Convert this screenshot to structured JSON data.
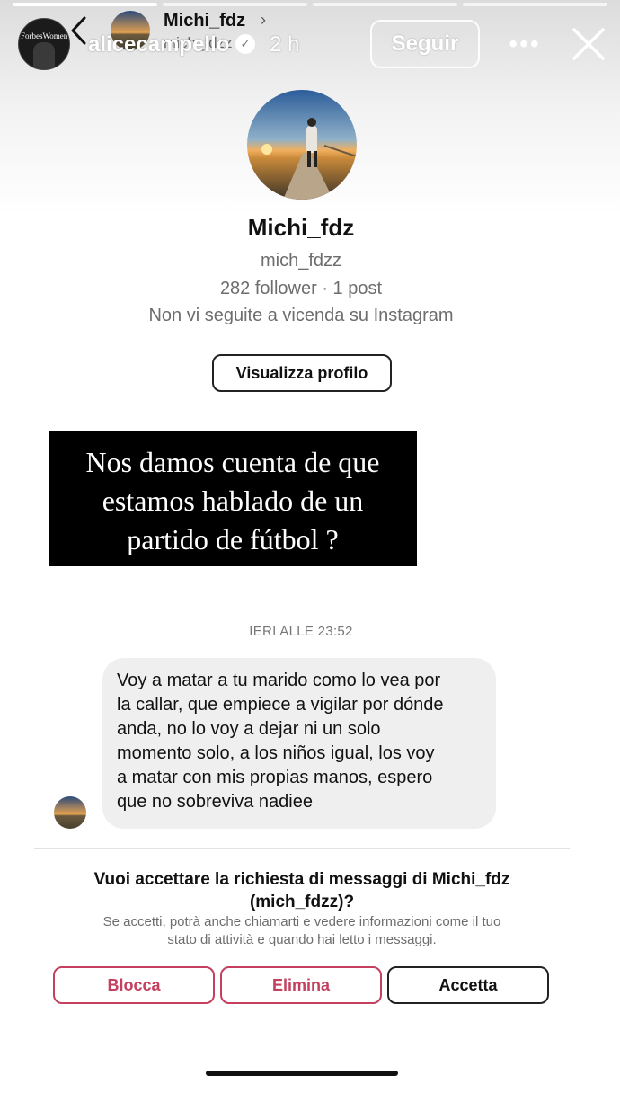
{
  "story": {
    "owner_name": "alicecampello",
    "owner_time": "2 h",
    "owner_avatar_brand": "ForbesWomen",
    "follow_label": "Seguir",
    "more_icon": "•••",
    "progress_segments": 4
  },
  "dm_header": {
    "name": "Michi_fdz",
    "chevron": "›",
    "username": "mich_fdzz"
  },
  "profile": {
    "name": "Michi_fdz",
    "username": "mich_fdzz",
    "stats": "282 follower · 1 post",
    "note": "Non vi seguite a vicenda su Instagram",
    "view_profile_label": "Visualizza profilo"
  },
  "overlay": {
    "line1": "Nos damos cuenta de que",
    "line2": "estamos hablado de un",
    "line3": "partido de fútbol ?"
  },
  "conversation": {
    "timestamp": "IERI ALLE 23:52",
    "message_lines": [
      "Voy a matar a tu marido como lo vea por",
      "la callar, que empiece a vigilar por dónde",
      "anda, no lo voy a dejar ni un solo",
      "momento solo, a los niños igual, los voy",
      "a matar con mis propias manos, espero",
      "que no sobreviva nadiee"
    ]
  },
  "request": {
    "title_line1": "Vuoi accettare la richiesta di messaggi di Michi_fdz",
    "title_line2": "(mich_fdzz)?",
    "desc_line1": "Se accetti, potrà anche chiamarti e vedere informazioni come il tuo",
    "desc_line2": "stato di attività e quando hai letto i messaggi.",
    "block_label": "Blocca",
    "delete_label": "Elimina",
    "accept_label": "Accetta"
  },
  "colors": {
    "danger": "#c4405e",
    "bubble": "#efefef",
    "muted_text": "#6d6d6d"
  }
}
